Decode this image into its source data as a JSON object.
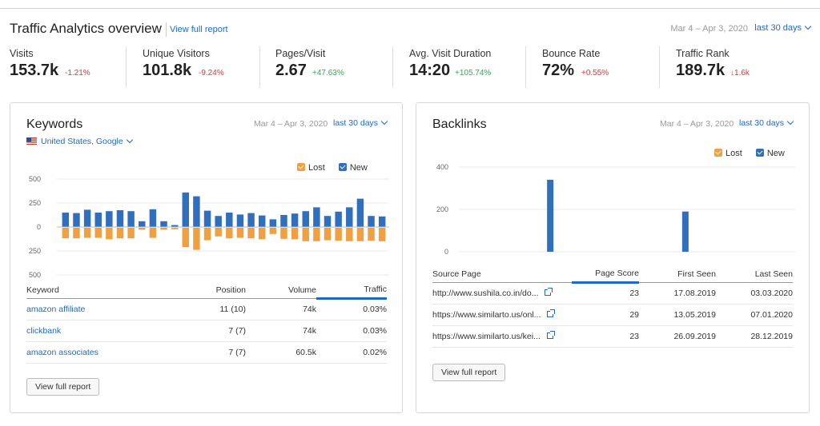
{
  "header": {
    "title": "Traffic Analytics overview",
    "report_link": "View full report",
    "date_range": "Mar 4 – Apr 3, 2020",
    "period": "last 30 days"
  },
  "metrics": [
    {
      "label": "Visits",
      "value": "153.7k",
      "change": "-1.21%",
      "trend": "neg"
    },
    {
      "label": "Unique Visitors",
      "value": "101.8k",
      "change": "-9.24%",
      "trend": "neg"
    },
    {
      "label": "Pages/Visit",
      "value": "2.67",
      "change": "+47.63%",
      "trend": "pos"
    },
    {
      "label": "Avg. Visit Duration",
      "value": "14:20",
      "change": "+105.74%",
      "trend": "pos"
    },
    {
      "label": "Bounce Rate",
      "value": "72%",
      "change": "+0.55%",
      "trend": "neg"
    },
    {
      "label": "Traffic Rank",
      "value": "189.7k",
      "change": "↓1.6k",
      "trend": "neg"
    }
  ],
  "keywords": {
    "title": "Keywords",
    "date_range": "Mar 4 – Apr 3, 2020",
    "period": "last 30 days",
    "region": "United States, Google",
    "legend": {
      "lost": "Lost",
      "new": "New"
    },
    "colors": {
      "lost": "#f0a040",
      "new": "#2f6fbd"
    },
    "table": {
      "headers": [
        "Keyword",
        "Position",
        "Volume",
        "Traffic"
      ],
      "rows": [
        [
          "amazon affiliate",
          "11 (10)",
          "74k",
          "0.03%"
        ],
        [
          "clickbank",
          "7 (7)",
          "74k",
          "0.03%"
        ],
        [
          "amazon associates",
          "7 (7)",
          "60.5k",
          "0.02%"
        ]
      ]
    },
    "button": "View full report"
  },
  "backlinks": {
    "title": "Backlinks",
    "date_range": "Mar 4 – Apr 3, 2020",
    "period": "last 30 days",
    "legend": {
      "lost": "Lost",
      "new": "New"
    },
    "table": {
      "headers": [
        "Source Page",
        "Page Score",
        "First Seen",
        "Last Seen"
      ],
      "rows": [
        [
          "http://www.sushila.co.in/do...",
          "23",
          "17.08.2019",
          "03.03.2020"
        ],
        [
          "https://www.similarto.us/onl...",
          "29",
          "13.05.2019",
          "07.01.2020"
        ],
        [
          "https://www.similarto.us/kei...",
          "23",
          "26.09.2019",
          "28.12.2019"
        ]
      ]
    },
    "button": "View full report"
  },
  "chart_data": [
    {
      "type": "bar",
      "ylim": [
        -500,
        500
      ],
      "yticks": [
        -500,
        -250,
        0,
        250,
        500
      ],
      "ytick_labels": [
        "500",
        "250",
        "0",
        "250",
        "500"
      ],
      "series": [
        {
          "name": "New",
          "values": [
            150,
            145,
            180,
            150,
            165,
            175,
            165,
            60,
            185,
            60,
            20,
            360,
            320,
            170,
            115,
            150,
            130,
            145,
            120,
            80,
            125,
            140,
            165,
            205,
            115,
            160,
            205,
            295,
            115,
            110
          ]
        },
        {
          "name": "Lost",
          "values": [
            -110,
            -110,
            -105,
            -105,
            -120,
            -110,
            -110,
            -20,
            -105,
            -20,
            -15,
            -200,
            -230,
            -130,
            -90,
            -110,
            -105,
            -110,
            -120,
            -65,
            -115,
            -120,
            -140,
            -140,
            -130,
            -135,
            -140,
            -140,
            -135,
            -140
          ]
        }
      ]
    },
    {
      "type": "bar",
      "ylim": [
        0,
        400
      ],
      "yticks": [
        0,
        200,
        400
      ],
      "series": [
        {
          "name": "New",
          "values": [
            0,
            0,
            0,
            0,
            0,
            0,
            0,
            0,
            0,
            0,
            0,
            0,
            0,
            0,
            0,
            0,
            0,
            0,
            0,
            0,
            0,
            0,
            0,
            0,
            0,
            0,
            0,
            0,
            0,
            0,
            0,
            0,
            340,
            0,
            0,
            0,
            0,
            0,
            0,
            0,
            0,
            0,
            0,
            0,
            0,
            0,
            0,
            0,
            0,
            0,
            0,
            0,
            0,
            0,
            0,
            0,
            0,
            0,
            0,
            0,
            0,
            0,
            0,
            0,
            0,
            0,
            0,
            0,
            0,
            0,
            0,
            0,
            0,
            0,
            0,
            0,
            0,
            0,
            0,
            0,
            0,
            190,
            0,
            0,
            0,
            0,
            0,
            0,
            0,
            0,
            0,
            0,
            0,
            0,
            0,
            0,
            0,
            0,
            0,
            0,
            0,
            0,
            0,
            0,
            0,
            0,
            0,
            0,
            0,
            0,
            0,
            0,
            0,
            0,
            0,
            0,
            0,
            0,
            0,
            0,
            0,
            0
          ]
        }
      ]
    }
  ]
}
